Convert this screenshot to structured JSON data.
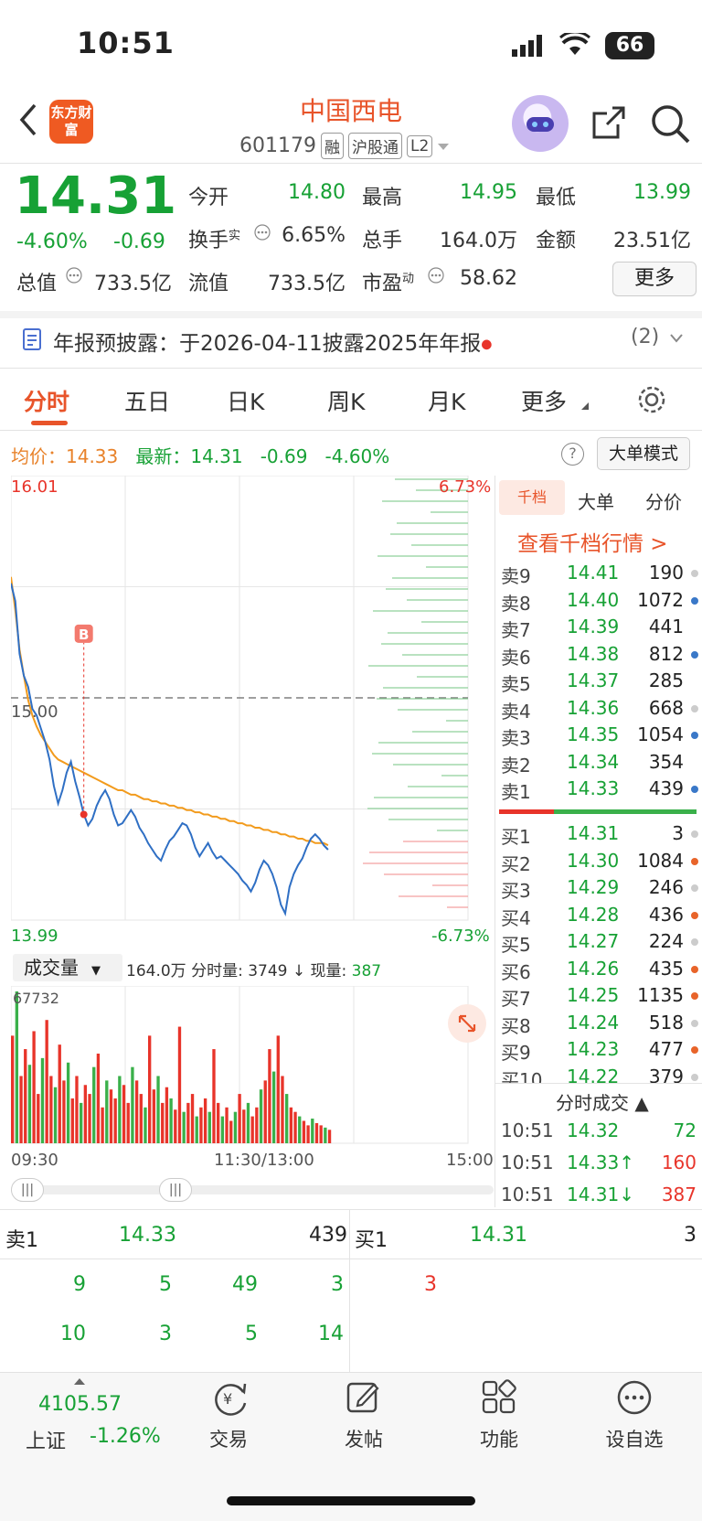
{
  "status": {
    "time": "10:51",
    "battery": "66"
  },
  "header": {
    "logo": "东方财富",
    "name": "中国西电",
    "code": "601179",
    "tags": [
      "融",
      "沪股通",
      "L2"
    ]
  },
  "quote": {
    "price": "14.31",
    "change_pct": "-4.60%",
    "change": "-0.69",
    "open_label": "今开",
    "open": "14.80",
    "high_label": "最高",
    "high": "14.95",
    "low_label": "最低",
    "low": "13.99",
    "turnover_label": "换手",
    "turnover_sup": "实",
    "turnover": "6.65%",
    "volume_label": "总手",
    "volume": "164.0万",
    "amount_label": "金额",
    "amount": "23.51亿",
    "mktcap_label": "总值",
    "mktcap": "733.5亿",
    "float_label": "流值",
    "float": "733.5亿",
    "pe_label": "市盈",
    "pe_sup": "动",
    "pe": "58.62",
    "more": "更多"
  },
  "notice": {
    "text": "年报预披露：于2026-04-11披露2025年年报",
    "count": "(2)"
  },
  "tabs": [
    "分时",
    "五日",
    "日K",
    "周K",
    "月K",
    "更多"
  ],
  "summary": {
    "avg_label": "均价：",
    "avg": "14.33",
    "last_label": "最新：",
    "last": "14.31",
    "chg": "-0.69",
    "chgp": "-4.60%",
    "bigorder": "大单模式",
    "help": "?"
  },
  "chart_data": {
    "type": "line",
    "title": "",
    "y_max": "16.01",
    "y_min": "13.99",
    "y_mid": "15.00",
    "pct_max": "6.73%",
    "pct_min": "-6.73%",
    "ylim": [
      13.99,
      16.01
    ],
    "price": [
      15.52,
      15.44,
      15.2,
      15.1,
      15.05,
      14.95,
      14.92,
      14.86,
      14.8,
      14.72,
      14.6,
      14.52,
      14.58,
      14.66,
      14.71,
      14.62,
      14.55,
      14.47,
      14.42,
      14.45,
      14.51,
      14.55,
      14.58,
      14.54,
      14.47,
      14.42,
      14.43,
      14.46,
      14.49,
      14.46,
      14.41,
      14.38,
      14.34,
      14.31,
      14.28,
      14.26,
      14.31,
      14.35,
      14.37,
      14.4,
      14.43,
      14.42,
      14.38,
      14.32,
      14.28,
      14.31,
      14.34,
      14.3,
      14.27,
      14.28,
      14.26,
      14.24,
      14.22,
      14.2,
      14.17,
      14.15,
      14.12,
      14.16,
      14.22,
      14.26,
      14.24,
      14.2,
      14.14,
      14.06,
      14.02,
      14.14,
      14.2,
      14.24,
      14.27,
      14.32,
      14.36,
      14.38,
      14.36,
      14.33,
      14.31
    ],
    "avg": [
      15.55,
      15.4,
      15.22,
      15.1,
      14.99,
      14.92,
      14.87,
      14.83,
      14.8,
      14.77,
      14.74,
      14.72,
      14.71,
      14.7,
      14.69,
      14.68,
      14.67,
      14.66,
      14.65,
      14.64,
      14.63,
      14.62,
      14.61,
      14.6,
      14.59,
      14.58,
      14.58,
      14.57,
      14.56,
      14.56,
      14.55,
      14.54,
      14.54,
      14.53,
      14.53,
      14.52,
      14.52,
      14.51,
      14.51,
      14.5,
      14.5,
      14.49,
      14.49,
      14.48,
      14.48,
      14.47,
      14.47,
      14.46,
      14.46,
      14.45,
      14.45,
      14.44,
      14.44,
      14.43,
      14.43,
      14.42,
      14.42,
      14.41,
      14.41,
      14.4,
      14.4,
      14.39,
      14.39,
      14.38,
      14.38,
      14.37,
      14.37,
      14.36,
      14.36,
      14.35,
      14.35,
      14.34,
      14.34,
      14.34,
      14.33
    ],
    "buy_marker": "B",
    "volume_max": "67732",
    "volume": [
      48000,
      67732,
      30000,
      42000,
      35000,
      50000,
      22000,
      38000,
      55000,
      30000,
      25000,
      44000,
      28000,
      36000,
      20000,
      30000,
      18000,
      26000,
      22000,
      34000,
      40000,
      16000,
      28000,
      24000,
      20000,
      30000,
      26000,
      18000,
      34000,
      28000,
      22000,
      16000,
      48000,
      24000,
      30000,
      18000,
      25000,
      20000,
      15000,
      52000,
      14000,
      18000,
      22000,
      12000,
      16000,
      20000,
      14000,
      42000,
      18000,
      12000,
      16000,
      10000,
      14000,
      22000,
      15000,
      18000,
      12000,
      16000,
      24000,
      28000,
      42000,
      32000,
      48000,
      30000,
      22000,
      16000,
      14000,
      12000,
      10000,
      8000,
      11000,
      9000,
      8000,
      7000,
      6000
    ],
    "vol_label": "成交量",
    "vol_info": "164.0万 分时量: 3749 ↓ 现量: ",
    "vol_now": "387",
    "x_ticks": [
      "09:30",
      "11:30/13:00",
      "15:00"
    ]
  },
  "depth": {
    "tabs": [
      "千档",
      "大单",
      "分价"
    ],
    "link": "查看千档行情 >",
    "asks": [
      {
        "l": "卖9",
        "p": "14.41",
        "v": "190",
        "d": "#ccc"
      },
      {
        "l": "卖8",
        "p": "14.40",
        "v": "1072",
        "d": "#3a78c8"
      },
      {
        "l": "卖7",
        "p": "14.39",
        "v": "441",
        "d": ""
      },
      {
        "l": "卖6",
        "p": "14.38",
        "v": "812",
        "d": "#3a78c8"
      },
      {
        "l": "卖5",
        "p": "14.37",
        "v": "285",
        "d": ""
      },
      {
        "l": "卖4",
        "p": "14.36",
        "v": "668",
        "d": "#ccc"
      },
      {
        "l": "卖3",
        "p": "14.35",
        "v": "1054",
        "d": "#3a78c8"
      },
      {
        "l": "卖2",
        "p": "14.34",
        "v": "354",
        "d": ""
      },
      {
        "l": "卖1",
        "p": "14.33",
        "v": "439",
        "d": "#3a78c8"
      }
    ],
    "bids": [
      {
        "l": "买1",
        "p": "14.31",
        "v": "3",
        "d": "#ccc"
      },
      {
        "l": "买2",
        "p": "14.30",
        "v": "1084",
        "d": "#e8642a"
      },
      {
        "l": "买3",
        "p": "14.29",
        "v": "246",
        "d": "#ccc"
      },
      {
        "l": "买4",
        "p": "14.28",
        "v": "436",
        "d": "#e8642a"
      },
      {
        "l": "买5",
        "p": "14.27",
        "v": "224",
        "d": "#ccc"
      },
      {
        "l": "买6",
        "p": "14.26",
        "v": "435",
        "d": "#e8642a"
      },
      {
        "l": "买7",
        "p": "14.25",
        "v": "1135",
        "d": "#e8642a"
      },
      {
        "l": "买8",
        "p": "14.24",
        "v": "518",
        "d": "#ccc"
      },
      {
        "l": "买9",
        "p": "14.23",
        "v": "477",
        "d": "#e8642a"
      },
      {
        "l": "买10",
        "p": "14.22",
        "v": "379",
        "d": "#ccc"
      }
    ],
    "ticks_title": "分时成交 ▲",
    "ticks": [
      {
        "t": "10:51",
        "p": "14.32",
        "v": "72"
      },
      {
        "t": "10:51",
        "p": "14.33↑",
        "v": "160"
      },
      {
        "t": "10:51",
        "p": "14.31↓",
        "v": "387"
      }
    ]
  },
  "quick": {
    "ask_label": "卖1",
    "ask_price": "14.33",
    "ask_vol": "439",
    "bid_label": "买1",
    "bid_price": "14.31",
    "bid_vol": "3",
    "ask_q1": [
      "9",
      "5",
      "49",
      "3"
    ],
    "ask_q2": [
      "10",
      "3",
      "5",
      "14"
    ],
    "bid_q1": [
      "3"
    ]
  },
  "nav": {
    "index_value": "4105.57",
    "index_name": "上证",
    "index_chg": "-1.26%",
    "items": [
      "交易",
      "发帖",
      "功能",
      "设自选"
    ]
  }
}
